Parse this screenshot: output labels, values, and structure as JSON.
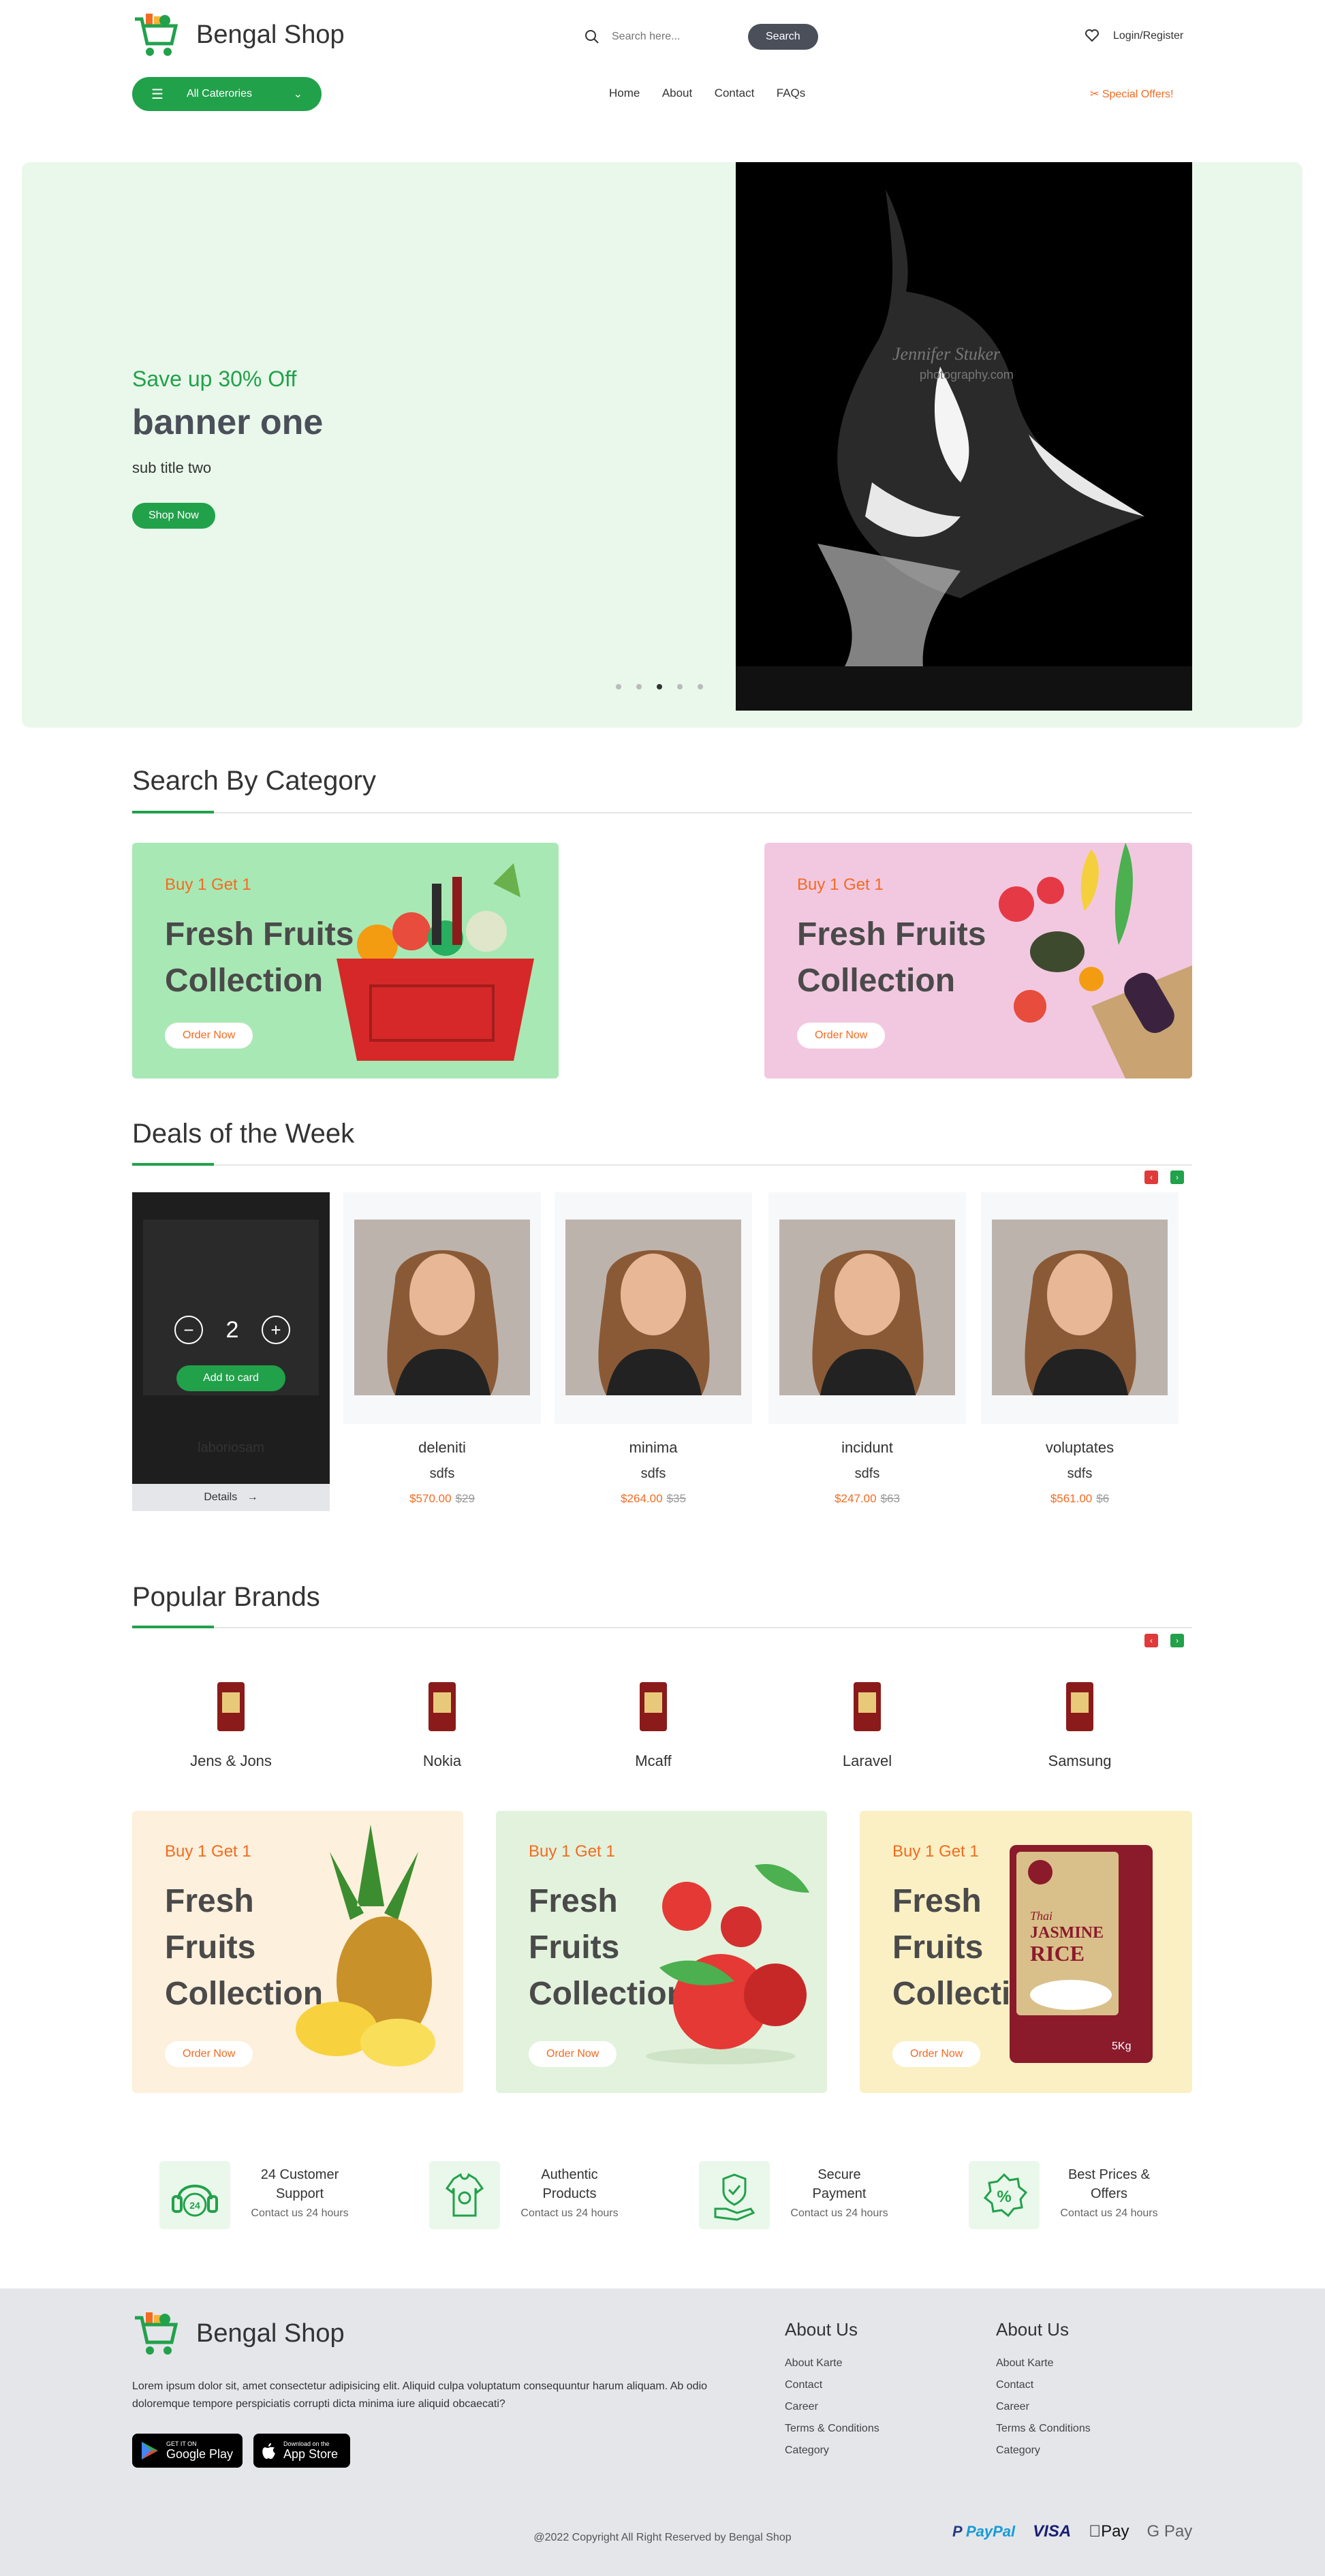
{
  "header": {
    "brand": "Bengal Shop",
    "search_placeholder": "Search here...",
    "search_button": "Search",
    "login": "Login/Register",
    "categories_button": "All Caterories",
    "nav": [
      "Home",
      "About",
      "Contact",
      "FAQs"
    ],
    "special_offers": "Special Offers!"
  },
  "hero": {
    "kicker": "Save up 30% Off",
    "title": "banner one",
    "subtitle": "sub title two",
    "button": "Shop Now",
    "image_watermark_1": "Jennifer Stuker",
    "image_watermark_2": "photography.com",
    "slide_count": 5,
    "active_slide": 3
  },
  "category_section": {
    "title": "Search By Category",
    "promos": [
      {
        "buy": "Buy 1 Get 1",
        "title_1": "Fresh Fruits",
        "title_2": "Collection",
        "button": "Order Now",
        "bg": "#a8e8b4"
      },
      {
        "buy": "Buy 1 Get 1",
        "title_1": "Fresh Fruits",
        "title_2": "Collection",
        "button": "Order Now",
        "bg": "#f2c8e0"
      }
    ]
  },
  "deals": {
    "title": "Deals of the Week",
    "hover_card": {
      "qty": "2",
      "add_button": "Add to card",
      "name": "laboriosam",
      "details": "Details"
    },
    "products": [
      {
        "name": "deleniti",
        "sub": "sdfs",
        "price": "$570.00",
        "old": "$29"
      },
      {
        "name": "minima",
        "sub": "sdfs",
        "price": "$264.00",
        "old": "$35"
      },
      {
        "name": "incidunt",
        "sub": "sdfs",
        "price": "$247.00",
        "old": "$63"
      },
      {
        "name": "voluptates",
        "sub": "sdfs",
        "price": "$561.00",
        "old": "$6"
      }
    ]
  },
  "brands": {
    "title": "Popular Brands",
    "items": [
      "Jens & Jons",
      "Nokia",
      "Mcaff",
      "Laravel",
      "Samsung"
    ]
  },
  "promos_bottom": [
    {
      "buy": "Buy 1 Get 1",
      "t1": "Fresh",
      "t2": "Fruits",
      "t3": "Collection",
      "button": "Order Now",
      "bg": "#fdf0dc"
    },
    {
      "buy": "Buy 1 Get 1",
      "t1": "Fresh",
      "t2": "Fruits",
      "t3": "Collection",
      "button": "Order Now",
      "bg": "#e2f2dc"
    },
    {
      "buy": "Buy 1 Get 1",
      "t1": "Fresh",
      "t2": "Fruits",
      "t3": "Collection",
      "button": "Order Now",
      "bg": "#fbf0c4"
    }
  ],
  "rice_label_1": "Thai",
  "rice_label_2": "JASMINE",
  "rice_label_3": "RICE",
  "rice_weight": "5Kg",
  "features": [
    {
      "t1": "24 Customer",
      "t2": "Support",
      "sub": "Contact us 24 hours",
      "icon": "headset-icon",
      "glyph": "24"
    },
    {
      "t1": "Authentic",
      "t2": "Products",
      "sub": "Contact us 24 hours",
      "icon": "shirt-icon",
      "glyph": ""
    },
    {
      "t1": "Secure",
      "t2": "Payment",
      "sub": "Contact us 24 hours",
      "icon": "secure-hand-icon",
      "glyph": ""
    },
    {
      "t1": "Best Prices &",
      "t2": "Offers",
      "sub": "Contact us 24 hours",
      "icon": "discount-icon",
      "glyph": "%"
    }
  ],
  "footer": {
    "brand": "Bengal Shop",
    "desc": "Lorem ipsum dolor sit, amet consectetur adipisicing elit. Aliquid culpa voluptatum consequuntur harum aliquam. Ab odio doloremque tempore perspiciatis corrupti dicta minima iure aliquid obcaecati?",
    "google_small": "GET IT ON",
    "google_big": "Google Play",
    "apple_small": "Download on the",
    "apple_big": "App Store",
    "col1": {
      "title": "About Us",
      "links": [
        "About Karte",
        "Contact",
        "Career",
        "Terms & Conditions",
        "Category"
      ]
    },
    "col2": {
      "title": "About Us",
      "links": [
        "About Karte",
        "Contact",
        "Career",
        "Terms & Conditions",
        "Category"
      ]
    },
    "copyright": "@2022 Copyright All Right Reserved by Bengal Shop",
    "payments": [
      "PayPal",
      "VISA",
      "Pay",
      "G Pay"
    ]
  },
  "colors": {
    "accent": "#22a14b",
    "orange": "#f36b21",
    "dark": "#4a4f5a"
  }
}
